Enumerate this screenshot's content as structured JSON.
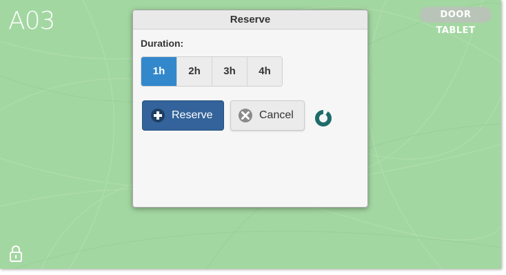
{
  "screen": {
    "room_name": "A03",
    "badge_label": "DOOR TABLET",
    "background_color": "#a3d7a1"
  },
  "dialog": {
    "title": "Reserve",
    "duration_label": "Duration:",
    "durations": [
      {
        "label": "1h",
        "selected": true
      },
      {
        "label": "2h",
        "selected": false
      },
      {
        "label": "3h",
        "selected": false
      },
      {
        "label": "4h",
        "selected": false
      }
    ],
    "reserve_button": {
      "label": "Reserve",
      "icon": "plus-circle-icon",
      "color": "#33639a"
    },
    "cancel_button": {
      "label": "Cancel",
      "icon": "x-circle-icon"
    },
    "loading_indicator": "spinner-icon"
  },
  "colors": {
    "accent": "#3388cc",
    "spinner": "#1e6b6b"
  }
}
